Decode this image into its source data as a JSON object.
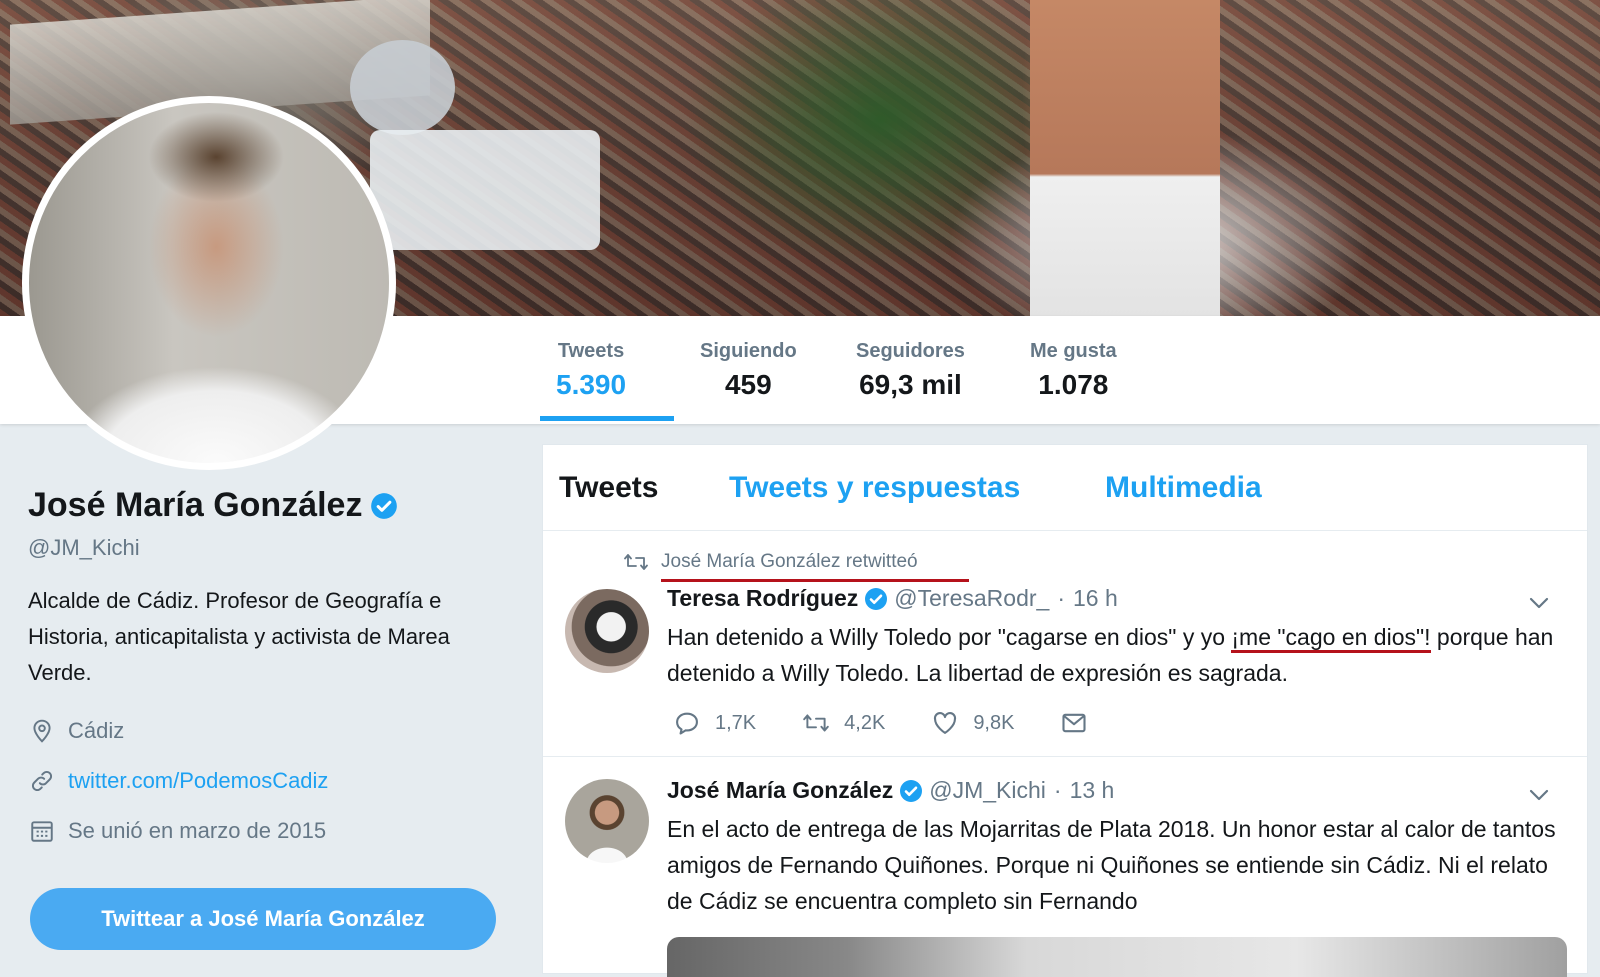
{
  "profile": {
    "name": "José María González",
    "handle": "@JM_Kichi",
    "bio": "Alcalde de Cádiz. Profesor de Geografía e Historia, anticapitalista y activista de Marea Verde.",
    "location": "Cádiz",
    "website": "twitter.com/PodemosCadiz",
    "joined": "Se unió en marzo de 2015",
    "tweet_to_button": "Twittear a José María González"
  },
  "stats": [
    {
      "label": "Tweets",
      "value": "5.390"
    },
    {
      "label": "Siguiendo",
      "value": "459"
    },
    {
      "label": "Seguidores",
      "value": "69,3 mil"
    },
    {
      "label": "Me gusta",
      "value": "1.078"
    }
  ],
  "tabs": [
    "Tweets",
    "Tweets y respuestas",
    "Multimedia"
  ],
  "tweets": [
    {
      "retweet_context": "José María González retwitteó",
      "author": "Teresa Rodríguez",
      "handle": "@TeresaRodr_",
      "time": "16 h",
      "text_before": "Han detenido a Willy Toledo por \"cagarse en dios\" y yo ",
      "text_highlight": "¡me \"cago en dios\"!",
      "text_after": " porque han detenido a Willy Toledo. La libertad de expresión es sagrada.",
      "replies": "1,7K",
      "retweets": "4,2K",
      "likes": "9,8K"
    },
    {
      "author": "José María González",
      "handle": "@JM_Kichi",
      "time": "13 h",
      "text": "En el acto de entrega de las Mojarritas de Plata 2018. Un honor estar al calor de tantos amigos de Fernando Quiñones. Porque ni Quiñones se entiende sin Cádiz. Ni el relato de Cádiz se encuentra completo sin Fernando"
    }
  ],
  "colors": {
    "accent": "#1da1f2",
    "text": "#14171a",
    "muted": "#657786",
    "background": "#e6ecf0",
    "annotation_red": "#b5121b"
  },
  "icons": [
    "verified-badge-icon",
    "location-icon",
    "link-icon",
    "calendar-icon",
    "retweet-icon",
    "reply-icon",
    "heart-icon",
    "envelope-icon",
    "chevron-down-icon"
  ]
}
